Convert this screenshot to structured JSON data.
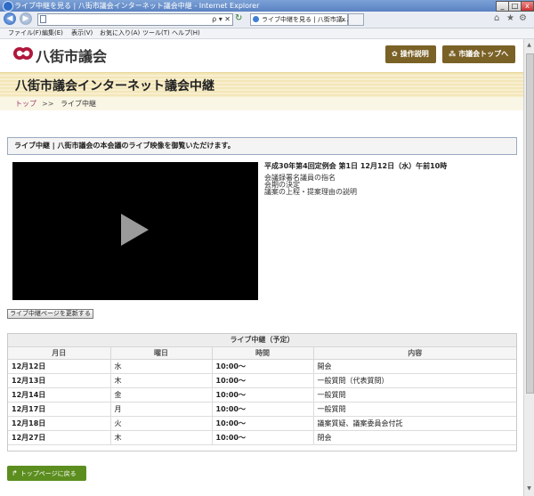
{
  "window": {
    "title": "ライブ中継を見る | 八街市議会インターネット議会中継 - Internet Explorer",
    "minimize": "_",
    "maximize": "□",
    "close": "x"
  },
  "browser": {
    "back": "◀",
    "forward": "▶",
    "address_tools": "ρ ▾ ✕",
    "refresh_glyph": "↻",
    "tab_label": "ライブ中継を見る | 八街市議...",
    "tab_close": "x",
    "home_glyph": "⌂",
    "favorites_glyph": "★",
    "settings_glyph": "⚙"
  },
  "menu": [
    "ファイル(F)",
    "編集(E)",
    "表示(V)",
    "お気に入り(A)",
    "ツール(T)",
    "ヘルプ(H)"
  ],
  "header": {
    "logo_text": "八街市議会",
    "manual_button": "操作説明",
    "top_button": "市議会トップへ",
    "colors": {
      "brown": "#7a6126",
      "logo_red": "#b0183b"
    }
  },
  "banner": {
    "title": "八街市議会インターネット議会中継"
  },
  "breadcrumb": {
    "home": "トップ",
    "sep": ">>",
    "current": "ライブ中継"
  },
  "notice": "ライブ中継 | 八街市議会の本会議のライブ映像を御覧いただけます。",
  "session": {
    "title": "平成30年第4回定例会 第1日 12月12日（水）午前10時",
    "agenda": [
      "会議録署名議員の指名",
      "会期の決定",
      "議案の上程・提案理由の説明"
    ]
  },
  "refresh_button": "ライブ中継ページを更新する",
  "schedule": {
    "caption": "ライブ中継（予定）",
    "headers": [
      "月日",
      "曜日",
      "時間",
      "内容"
    ],
    "rows": [
      [
        "12月12日",
        "水",
        "10:00～",
        "開会"
      ],
      [
        "12月13日",
        "木",
        "10:00～",
        "一般質問（代表質問）"
      ],
      [
        "12月14日",
        "金",
        "10:00～",
        "一般質問"
      ],
      [
        "12月17日",
        "月",
        "10:00～",
        "一般質問"
      ],
      [
        "12月18日",
        "火",
        "10:00～",
        "議案質疑、議案委員会付託"
      ],
      [
        "12月27日",
        "木",
        "10:00～",
        "閉会"
      ]
    ]
  },
  "back_button": "トップページに戻る",
  "scroll": {
    "up": "▲",
    "down": "▼"
  }
}
